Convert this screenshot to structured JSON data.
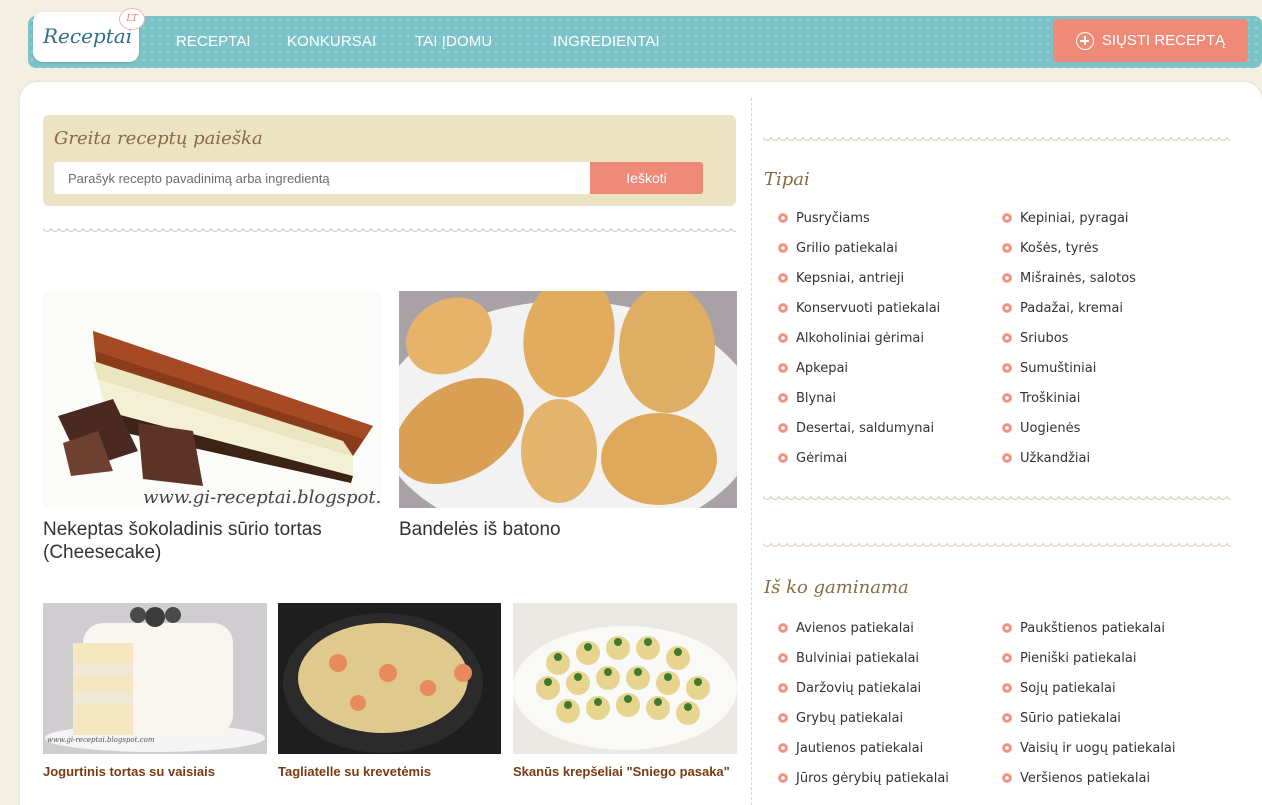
{
  "header": {
    "logo_text": "Receptai",
    "logo_badge": "LT",
    "nav": [
      "RECEPTAI",
      "KONKURSAI",
      "TAI ĮDOMU",
      "INGREDIENTAI"
    ],
    "send_button": "SIŲSTI RECEPTĄ",
    "colors": {
      "nav": "#7cc3c9",
      "accent": "#ef8a78"
    }
  },
  "search": {
    "title": "Greita receptų paieška",
    "placeholder": "Parašyk recepto pavadinimą arba ingredientą",
    "button": "Ieškoti"
  },
  "featured": [
    {
      "title": "Nekeptas šokoladinis sūrio tortas (Cheesecake)",
      "watermark": "www.gi-receptai.blogspot.com"
    },
    {
      "title": "Bandelės iš batono"
    }
  ],
  "recipes": [
    {
      "title": "Jogurtinis tortas su vaisiais",
      "watermark": "www.gi-receptai.blogspot.com"
    },
    {
      "title": "Tagliatelle su krevetėmis"
    },
    {
      "title": "Skanūs krepšeliai \"Sniego pasaka\""
    }
  ],
  "sidebar": {
    "types": {
      "title": "Tipai",
      "left": [
        "Pusryčiams",
        "Grilio patiekalai",
        "Kepsniai, antrieji",
        "Konservuoti patiekalai",
        "Alkoholiniai gėrimai",
        "Apkepai",
        "Blynai",
        "Desertai, saldumynai",
        "Gėrimai"
      ],
      "right": [
        "Kepiniai, pyragai",
        "Košės, tyrės",
        "Mišrainės, salotos",
        "Padažai, kremai",
        "Sriubos",
        "Sumuštiniai",
        "Troškiniai",
        "Uogienės",
        "Užkandžiai"
      ]
    },
    "made_from": {
      "title": "Iš ko gaminama",
      "left": [
        "Avienos patiekalai",
        "Bulviniai patiekalai",
        "Daržovių patiekalai",
        "Grybų patiekalai",
        "Jautienos patiekalai",
        "Jūros gėrybių patiekalai"
      ],
      "right": [
        "Paukštienos patiekalai",
        "Pieniški patiekalai",
        "Sojų patiekalai",
        "Sūrio patiekalai",
        "Vaisių ir uogų patiekalai",
        "Veršienos patiekalai"
      ]
    }
  }
}
